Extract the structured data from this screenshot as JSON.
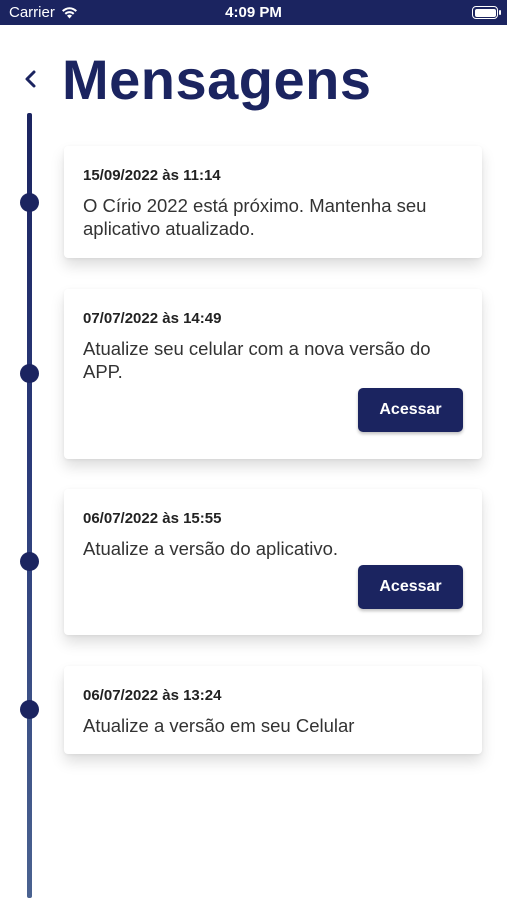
{
  "status_bar": {
    "carrier": "Carrier",
    "time": "4:09 PM",
    "battery_level": 1.0
  },
  "header": {
    "title": "Mensagens",
    "back_icon": "chevron-left-icon"
  },
  "colors": {
    "primary": "#1b2460",
    "background": "#ffffff",
    "text": "#333333"
  },
  "messages": [
    {
      "date": "15/09/2022 às 11:14",
      "text": "O Círio 2022 está próximo. Mantenha seu aplicativo atualizado."
    },
    {
      "date": "07/07/2022 às 14:49",
      "text": "Atualize seu celular com a nova versão do APP.",
      "button_label": "Acessar"
    },
    {
      "date": "06/07/2022 às 15:55",
      "text": "Atualize a versão do aplicativo.",
      "button_label": "Acessar"
    },
    {
      "date": "06/07/2022 às 13:24",
      "text": "Atualize a versão em seu Celular"
    }
  ]
}
